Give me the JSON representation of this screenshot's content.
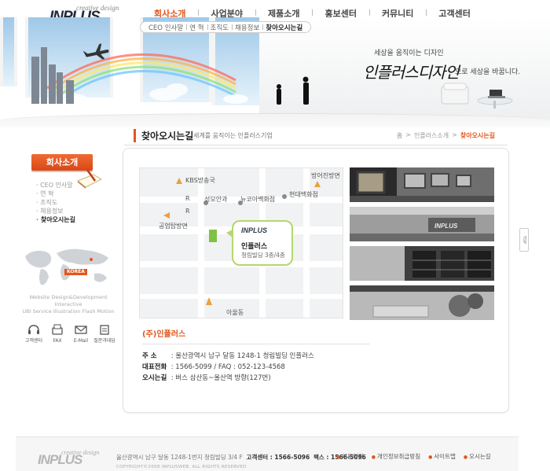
{
  "header": {
    "logo_tag": "creative design",
    "logo_word": "INPLUS",
    "gnb": [
      {
        "label": "회사소개"
      },
      {
        "label": "사업분야"
      },
      {
        "label": "제품소개"
      },
      {
        "label": "홍보센터"
      },
      {
        "label": "커뮤니티"
      },
      {
        "label": "고객센터"
      }
    ],
    "lnb": [
      {
        "label": "CEO 인사말"
      },
      {
        "label": "연   혁"
      },
      {
        "label": "조직도"
      },
      {
        "label": "채용정보"
      },
      {
        "label": "찾아오시는길"
      }
    ]
  },
  "visual": {
    "slogan_top": "세상을 움직이는 디자인",
    "slogan_main": "인플러스디자인",
    "slogan_tail": "으로 세상을 바꿉니다."
  },
  "title_bar": {
    "title": "찾아오시는길",
    "subtitle": "세계를 움직이는 인플러스기업",
    "breadcrumb": [
      "홈",
      ">",
      "인플러스소개",
      ">",
      "찾아오시는길"
    ]
  },
  "side": {
    "title": "회사소개",
    "menu": [
      "CEO 인사말",
      "연   혁",
      "조직도",
      "채용정보",
      "찾아오시는길"
    ],
    "korea_label": "KOREA",
    "caption_line1": "Website Design&Development  Interactive",
    "caption_line2": "UBI Service  Illustration  Flash Motion",
    "quick": [
      "고객센터",
      "FAX",
      "E-Mail",
      "질문과대답"
    ]
  },
  "map": {
    "labels": {
      "kbs": "KBS방송국",
      "eobjin": "방어진방면",
      "seongmo": "성모안과",
      "newcore": "뉴코아백화점",
      "hyundai": "현대백화점",
      "r1": "R",
      "r2": "R",
      "gongeop": "공업탑방면",
      "ayang": "아울동"
    },
    "bubble_logo": "INPLUS",
    "bubble_name": "인플러스",
    "bubble_building": "청림빌딩 3층/4층"
  },
  "info": {
    "company": "(주)인플러스",
    "rows": [
      {
        "key": "주    소",
        "value": "울산광역시 남구 달동 1248-1 청림빌딩 인플러스"
      },
      {
        "key": "대표전화",
        "value": "1566-5099 / FAQ : 052-123-4568"
      },
      {
        "key": "오시는길",
        "value": "버스 삼산동~울산역 방향(127번)"
      }
    ]
  },
  "top_button": "TOP",
  "footer": {
    "logo_tag": "creative design",
    "logo_word": "INPLUS",
    "address": "울산광역시 남구 달동 1248-1번지 청림빌딩 3/4 F",
    "center_label": "고객센터 : 1566-5096",
    "fax_label": "팩스 : 1566-5096",
    "copyright": "COPYRIGHT©2008 INPLUSWEB. ALL RIGHTS RESERVED",
    "links": [
      "이용약관",
      "개인정보취급방침",
      "사이트맵",
      "오시는길"
    ]
  }
}
